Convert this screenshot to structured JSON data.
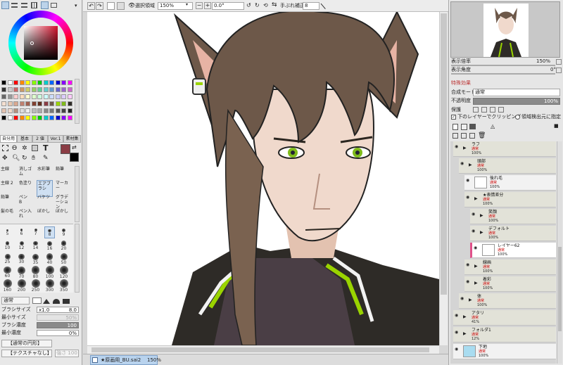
{
  "toolbar": {
    "select_label": "選択領域",
    "zoom": "150%",
    "rotation": "0.0°",
    "stabilizer_label": "手ぶれ補正",
    "stabilizer_value": "8"
  },
  "left_panel": {
    "tool_tabs": [
      "自分用",
      "基本",
      "2 値",
      "Ver.1",
      "素材集"
    ],
    "tools": [
      {
        "label": "主線",
        "sub": ""
      },
      {
        "label": "消しゴム",
        "sub": ""
      },
      {
        "label": "水彩筆",
        "sub": ""
      },
      {
        "label": "鉛筆",
        "sub": ""
      },
      {
        "label": "主線 2",
        "sub": ""
      },
      {
        "label": "色塗り",
        "sub": ""
      },
      {
        "label": "エアブラシ",
        "sub": ""
      },
      {
        "label": "マーカー",
        "sub": ""
      },
      {
        "label": "鉛筆",
        "sub": ""
      },
      {
        "label": "ペン",
        "sub": "B"
      },
      {
        "label": "バケツ",
        "sub": ""
      },
      {
        "label": "グラデーション",
        "sub": ""
      },
      {
        "label": "髪の毛",
        "sub": ""
      },
      {
        "label": "ペン入れ",
        "sub": ""
      },
      {
        "label": "ぼかし",
        "sub": ""
      },
      {
        "label": "ぼかし",
        "sub": ""
      }
    ],
    "brush_sizes": [
      "5",
      "6",
      "7",
      "8",
      "9",
      "10",
      "12",
      "14",
      "16",
      "20",
      "25",
      "30",
      "35",
      "40",
      "50",
      "60",
      "70",
      "80",
      "100",
      "120",
      "160",
      "200",
      "250",
      "300",
      "350"
    ],
    "blend_mode": "通常",
    "brush_size_label": "ブラシサイズ",
    "brush_size_mult": "x1.0",
    "brush_size_value": "8.0",
    "min_size_label": "最小サイズ",
    "min_size_value": "50%",
    "brush_density_label": "ブラシ濃度",
    "brush_density_value": "100",
    "min_density_label": "最小濃度",
    "min_density_value": "0%",
    "shape_select": "【通常の円形】",
    "texture_select": "【テクスチャなし】",
    "texture_strength": "強さ 100"
  },
  "right_panel": {
    "display_zoom_label": "表示倍率",
    "display_zoom_value": "150%",
    "display_angle_label": "表示角度",
    "display_angle_value": "0°",
    "effects_label": "特殊効果",
    "blend_label": "合成モード",
    "blend_value": "通常",
    "opacity_label": "不透明度",
    "opacity_value": "100%",
    "protect_label": "保護",
    "clip_label": "下のレイヤーでクリッピング",
    "select_source_label": "領域検出元に指定"
  },
  "layers": [
    {
      "name": "ラフ",
      "mode": "通常",
      "opacity": "100%",
      "folder": true,
      "indent": 0
    },
    {
      "name": "頭部",
      "mode": "通常",
      "opacity": "100%",
      "folder": true,
      "indent": 1
    },
    {
      "name": "後れ毛",
      "mode": "通常",
      "opacity": "100%",
      "folder": false,
      "indent": 2
    },
    {
      "name": "★表情差分",
      "mode": "通常",
      "opacity": "100%",
      "folder": true,
      "indent": 2
    },
    {
      "name": "笑顔",
      "mode": "通常",
      "opacity": "100%",
      "folder": true,
      "indent": 3
    },
    {
      "name": "デフォルト",
      "mode": "通常",
      "opacity": "100%",
      "folder": true,
      "indent": 3
    },
    {
      "name": "レイヤー62",
      "mode": "通常",
      "opacity": "100%",
      "folder": false,
      "indent": 3,
      "selected": true
    },
    {
      "name": "線画",
      "mode": "通常",
      "opacity": "100%",
      "folder": true,
      "indent": 2
    },
    {
      "name": "着彩",
      "mode": "通常",
      "opacity": "100%",
      "folder": true,
      "indent": 2
    },
    {
      "name": "体",
      "mode": "通常",
      "opacity": "100%",
      "folder": true,
      "indent": 1
    },
    {
      "name": "アタリ",
      "mode": "通常",
      "opacity": "41%",
      "folder": true,
      "indent": 0
    },
    {
      "name": "フォルダ1",
      "mode": "通常",
      "opacity": "12%",
      "folder": true,
      "indent": 0
    },
    {
      "name": "下地",
      "mode": "通常",
      "opacity": "100%",
      "folder": false,
      "indent": 0
    }
  ],
  "status": {
    "file_name": "★原画用_BU.sai2",
    "zoom": "150%"
  },
  "colors": {
    "main_color": "#8a3c44",
    "sub_color": "#000000",
    "accent_green": "#9ad400",
    "selected_layer_marker": "#e0508a"
  }
}
